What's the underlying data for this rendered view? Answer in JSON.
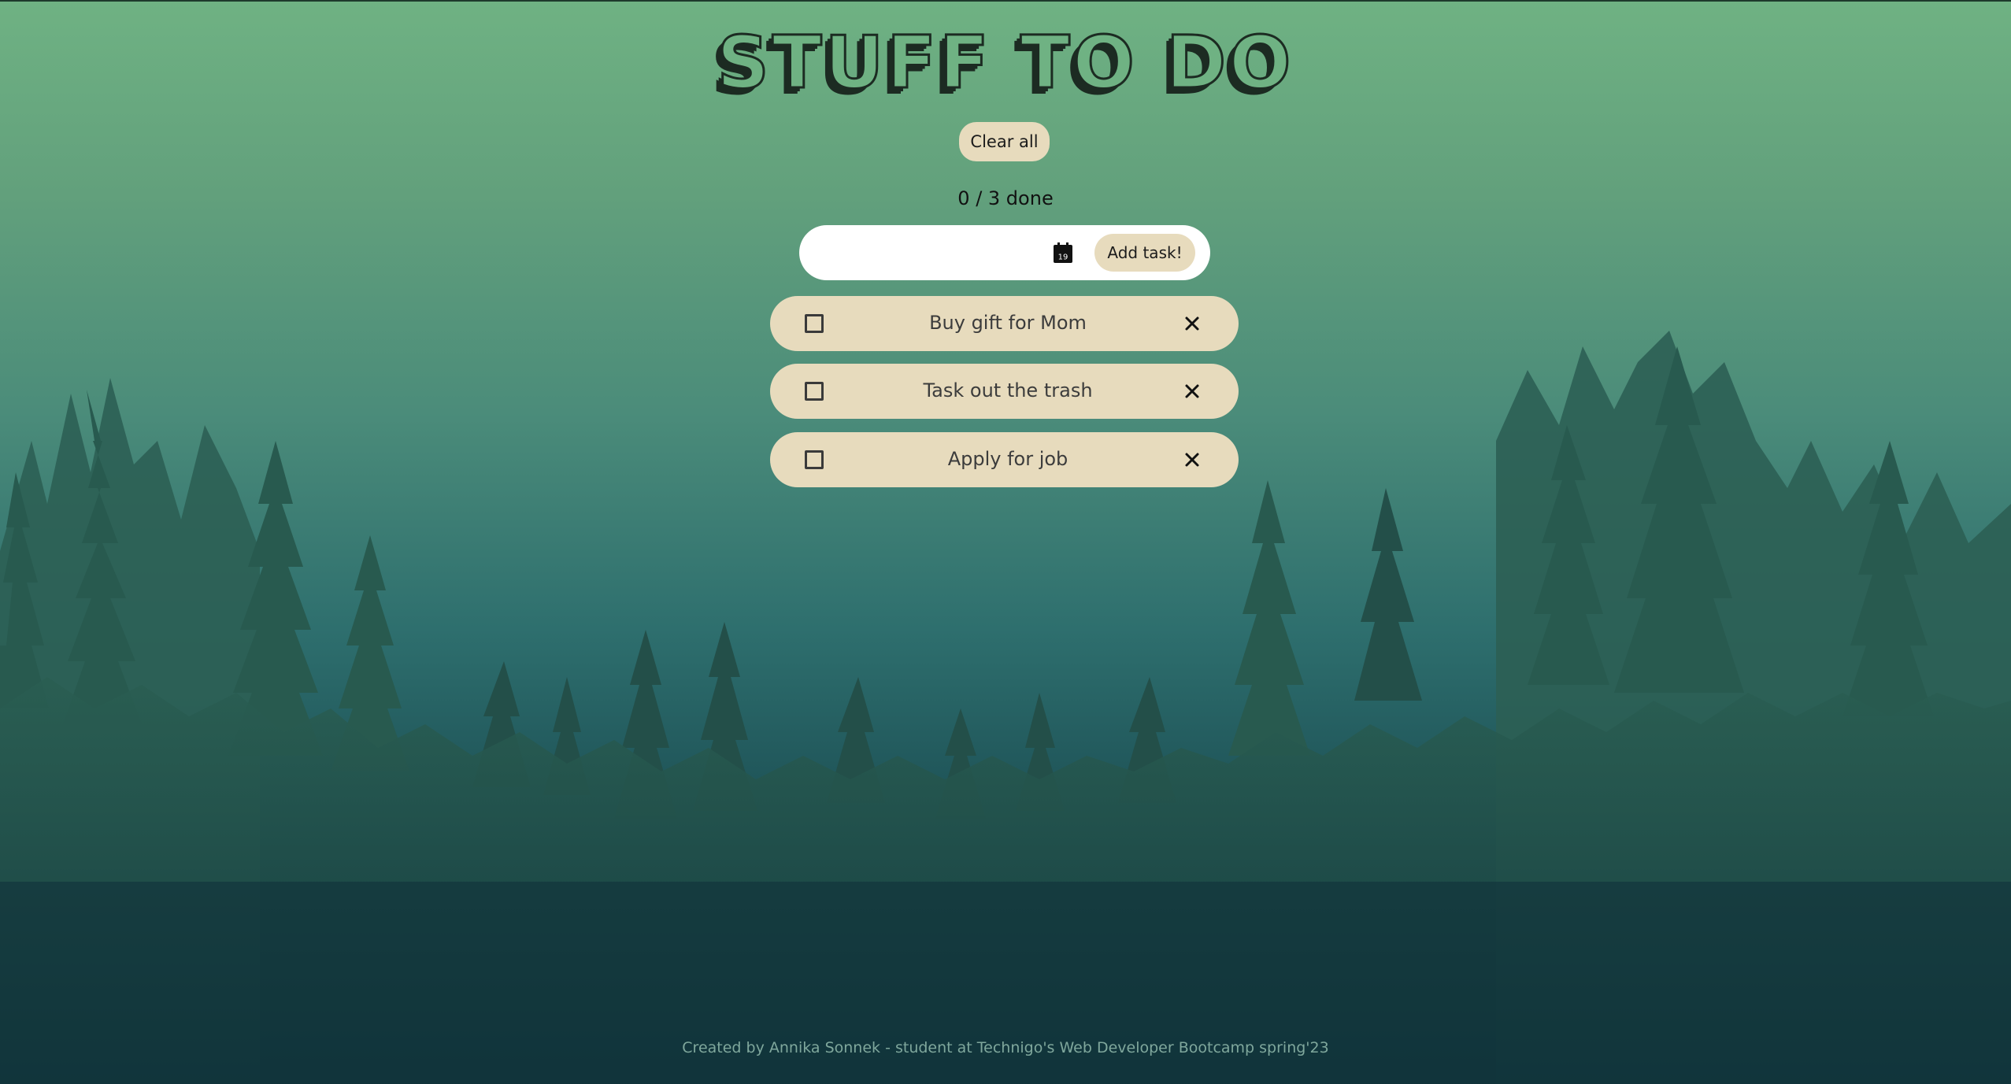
{
  "app": {
    "title": "STUFF TO DO",
    "clear_all_label": "Clear all",
    "counter_text": "0 / 3 done"
  },
  "add_form": {
    "input_value": "",
    "input_placeholder": "",
    "date_icon": "calendar-icon",
    "date_icon_day": "19",
    "add_button_label": "Add task!"
  },
  "tasks": [
    {
      "text": "Buy gift for Mom",
      "done": false
    },
    {
      "text": "Task out the trash",
      "done": false
    },
    {
      "text": "Apply for job",
      "done": false
    }
  ],
  "footer": {
    "text": "Created by Annika Sonnek - student at Technigo's Web Developer Bootcamp spring'23"
  },
  "colors": {
    "accent_beige": "#e7dbbd",
    "title_green": "#6fb283",
    "title_dark": "#1c2b22",
    "forest_dark": "#1f4b44",
    "background_top": "#6fb283",
    "background_bottom": "#0e2e38"
  },
  "icons": {
    "checkbox": "checkbox-icon",
    "remove": "close-icon",
    "date": "calendar-icon"
  }
}
